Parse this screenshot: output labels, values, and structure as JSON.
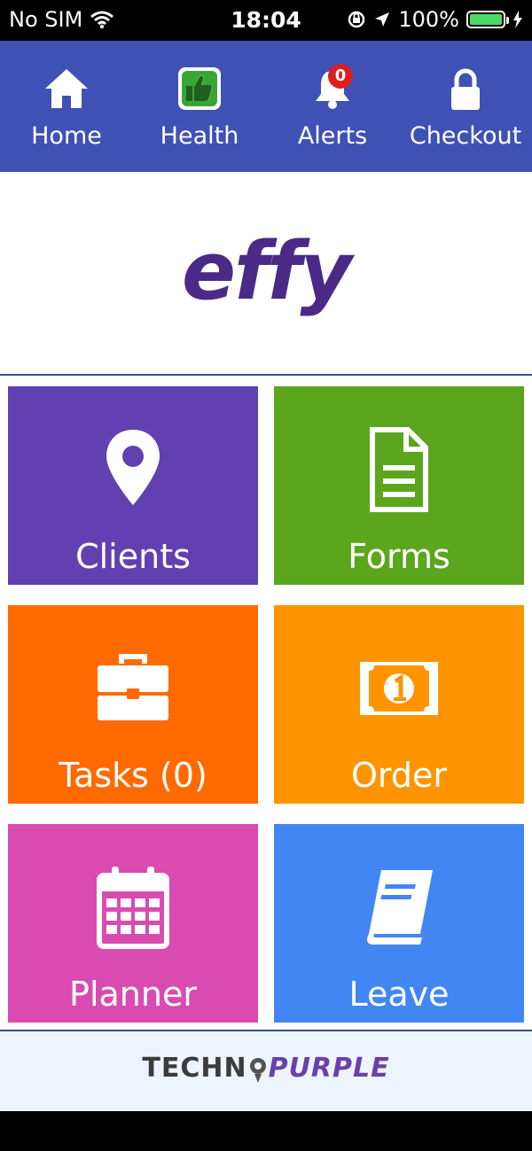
{
  "status_bar": {
    "carrier": "No SIM",
    "time": "18:04",
    "battery": "100%"
  },
  "nav": {
    "items": [
      {
        "label": "Home",
        "icon": "home-icon"
      },
      {
        "label": "Health",
        "icon": "thumbs-up-icon"
      },
      {
        "label": "Alerts",
        "icon": "bell-icon",
        "badge": "0"
      },
      {
        "label": "Checkout",
        "icon": "lock-icon"
      }
    ]
  },
  "logo": {
    "text": "effy"
  },
  "tiles": [
    {
      "label": "Clients",
      "icon": "map-pin-icon",
      "color": "#6140b2"
    },
    {
      "label": "Forms",
      "icon": "document-icon",
      "color": "#5ba61d"
    },
    {
      "label": "Tasks (0)",
      "icon": "briefcase-icon",
      "color": "#ff6a00"
    },
    {
      "label": "Order",
      "icon": "money-icon",
      "color": "#ff9400"
    },
    {
      "label": "Planner",
      "icon": "calendar-icon",
      "color": "#d94bb0"
    },
    {
      "label": "Leave",
      "icon": "book-icon",
      "color": "#4286f4"
    }
  ],
  "footer": {
    "brand_left": "TECHN",
    "brand_right": "PURPLE"
  },
  "colors": {
    "nav_bg": "#3f51b5",
    "logo": "#4a2a86"
  }
}
